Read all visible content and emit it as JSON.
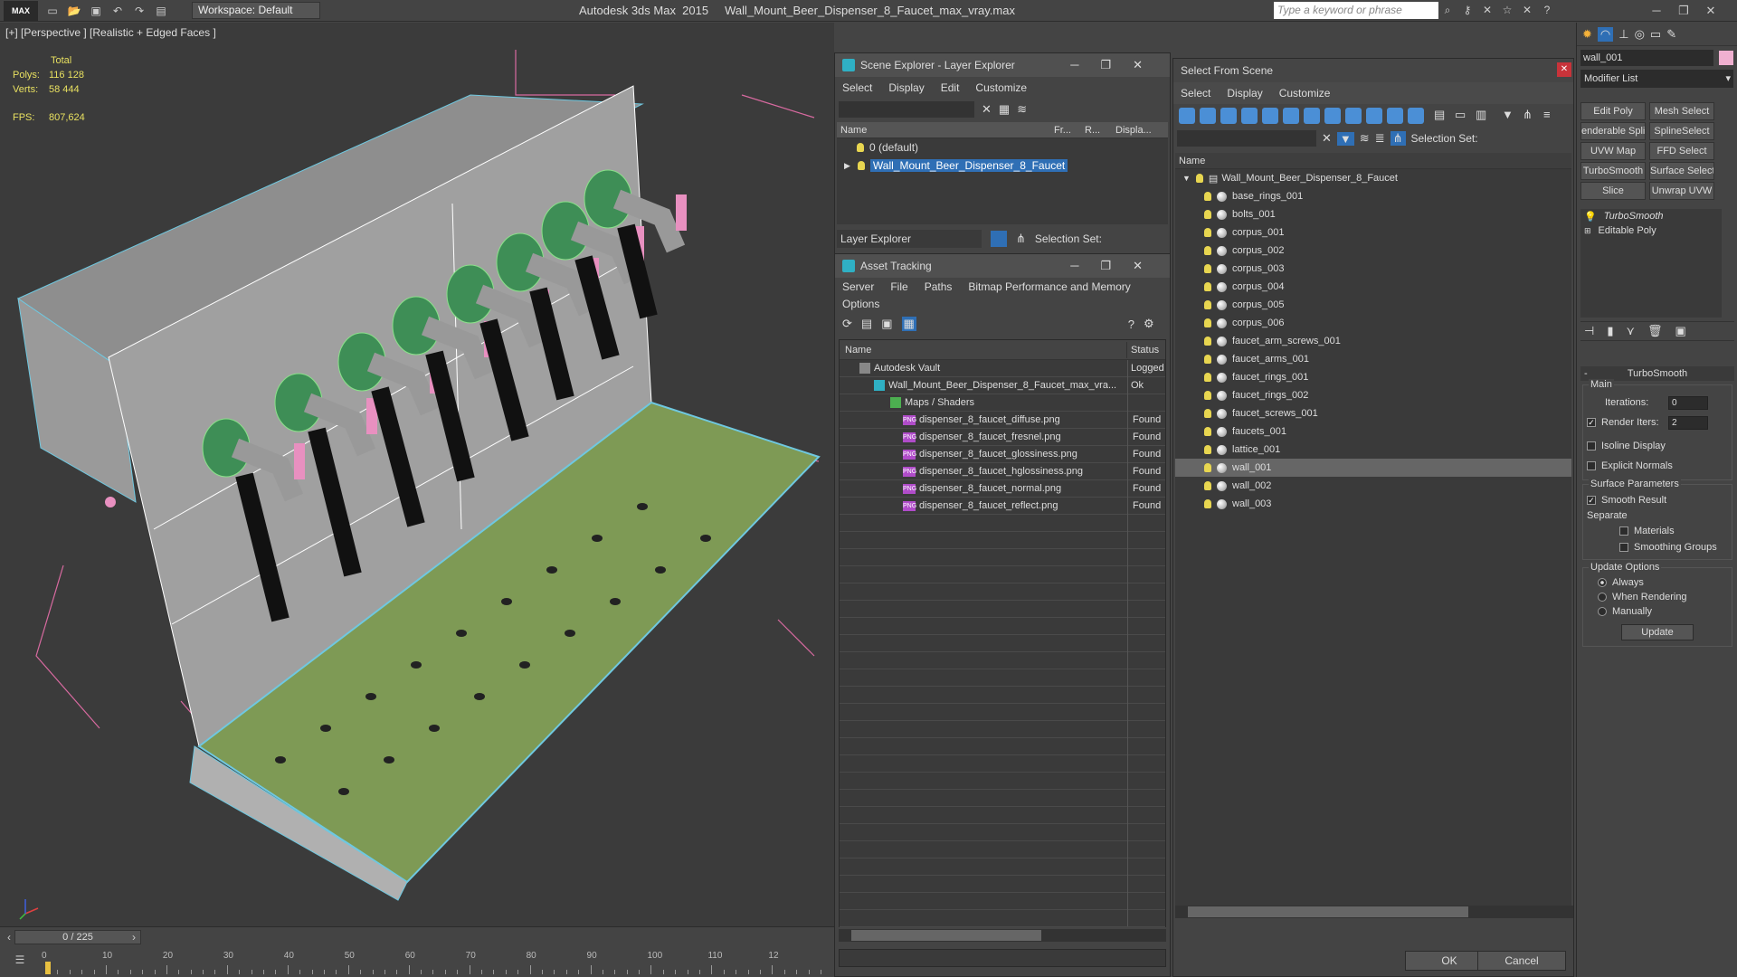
{
  "titlebar": {
    "logo": "MAX",
    "workspace": "Workspace: Default",
    "app_title": "Autodesk 3ds Max  2015     Wall_Mount_Beer_Dispenser_8_Faucet_max_vray.max",
    "search_placeholder": "Type a keyword or phrase"
  },
  "viewport": {
    "label": "[+] [Perspective ] [Realistic + Edged Faces ]",
    "stats": {
      "total_label": "Total",
      "polys_label": "Polys:",
      "polys_value": "116 128",
      "verts_label": "Verts:",
      "verts_value": "58 444",
      "fps_label": "FPS:",
      "fps_value": "807,624"
    }
  },
  "timeline": {
    "frame": "0 / 225",
    "ticks": [
      "0",
      "10",
      "20",
      "30",
      "40",
      "50",
      "60",
      "70",
      "80",
      "90",
      "100",
      "110",
      "12"
    ]
  },
  "layer_explorer": {
    "title": "Scene Explorer - Layer Explorer",
    "menu": [
      "Select",
      "Display",
      "Edit",
      "Customize"
    ],
    "columns": [
      "Name",
      "Fr...",
      "R...",
      "Displa..."
    ],
    "rows": [
      "0 (default)",
      "Wall_Mount_Beer_Dispenser_8_Faucet"
    ],
    "footer_dropdown": "Layer Explorer",
    "selection_set": "Selection Set:"
  },
  "asset_tracking": {
    "title": "Asset Tracking",
    "menu": [
      "Server",
      "File",
      "Paths",
      "Bitmap Performance and Memory",
      "Options"
    ],
    "columns": [
      "Name",
      "Status"
    ],
    "rows": [
      {
        "name": "Autodesk Vault",
        "status": "Logged"
      },
      {
        "name": "Wall_Mount_Beer_Dispenser_8_Faucet_max_vra...",
        "status": "Ok"
      },
      {
        "name": "Maps / Shaders",
        "status": ""
      },
      {
        "name": "dispenser_8_faucet_diffuse.png",
        "status": "Found"
      },
      {
        "name": "dispenser_8_faucet_fresnel.png",
        "status": "Found"
      },
      {
        "name": "dispenser_8_faucet_glossiness.png",
        "status": "Found"
      },
      {
        "name": "dispenser_8_faucet_hglossiness.png",
        "status": "Found"
      },
      {
        "name": "dispenser_8_faucet_normal.png",
        "status": "Found"
      },
      {
        "name": "dispenser_8_faucet_reflect.png",
        "status": "Found"
      }
    ]
  },
  "select_from_scene": {
    "title": "Select From Scene",
    "menu": [
      "Select",
      "Display",
      "Customize"
    ],
    "selection_set": "Selection Set:",
    "column": "Name",
    "root": "Wall_Mount_Beer_Dispenser_8_Faucet",
    "objects": [
      "base_rings_001",
      "bolts_001",
      "corpus_001",
      "corpus_002",
      "corpus_003",
      "corpus_004",
      "corpus_005",
      "corpus_006",
      "faucet_arm_screws_001",
      "faucet_arms_001",
      "faucet_rings_001",
      "faucet_rings_002",
      "faucet_screws_001",
      "faucets_001",
      "lattice_001",
      "wall_001",
      "wall_002",
      "wall_003"
    ],
    "selected": "wall_001",
    "ok": "OK",
    "cancel": "Cancel"
  },
  "command_panel": {
    "object_name": "wall_001",
    "modifier_list": "Modifier List",
    "buttons": [
      "Edit Poly",
      "Mesh Select",
      "enderable Splin",
      "SplineSelect",
      "UVW Map",
      "FFD Select",
      "TurboSmooth",
      "Surface Select",
      "Slice",
      "Unwrap UVW"
    ],
    "stack": [
      "TurboSmooth",
      "Editable Poly"
    ],
    "rollout_title": "TurboSmooth",
    "main": "Main",
    "iterations_label": "Iterations:",
    "iterations_value": "0",
    "render_iters_label": "Render Iters:",
    "render_iters_value": "2",
    "isoline": "Isoline Display",
    "explicit": "Explicit Normals",
    "surface_params": "Surface Parameters",
    "smooth_result": "Smooth Result",
    "separate": "Separate",
    "materials": "Materials",
    "smoothing_groups": "Smoothing Groups",
    "update_options": "Update Options",
    "always": "Always",
    "when_rendering": "When Rendering",
    "manually": "Manually",
    "update": "Update"
  }
}
